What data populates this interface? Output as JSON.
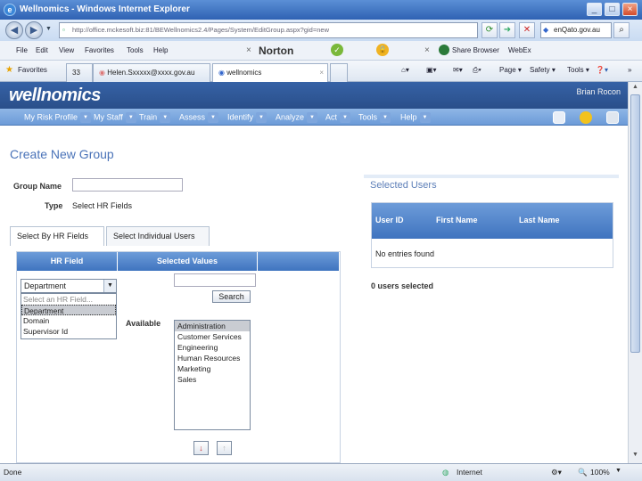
{
  "browser": {
    "title": "Wellnomics - Windows Internet Explorer",
    "address": "http://office.mckesoft.biz:81/BEWellnomics2.4/Pages/System/EditGroup.aspx?gid=new",
    "search_value": "enQato.gov.au",
    "norton": "Norton",
    "share_browser": "Share Browser",
    "webex": "WebEx",
    "menu": [
      "File",
      "Edit",
      "View",
      "Favorites",
      "Tools",
      "Help"
    ],
    "favorites_label": "Favorites",
    "tabs": [
      "Helen.Sxxxxx@xxxx.gov.au",
      "wellnomics"
    ],
    "tab_count": "33",
    "commands": [
      "Page",
      "Safety",
      "Tools"
    ],
    "status_left": "Done",
    "status_zone": "Internet",
    "zoom": "100%"
  },
  "app": {
    "logo": "wellnomics",
    "user": "Brian Rocon",
    "nav": [
      "My Risk Profile",
      "My Staff",
      "Train",
      "Assess",
      "Identify",
      "Analyze",
      "Act",
      "Tools",
      "Help"
    ]
  },
  "page": {
    "title": "Create New Group",
    "group_name_label": "Group Name",
    "group_name_value": "",
    "type_label": "Type",
    "type_value": "Select HR Fields",
    "tabs": [
      "Select By HR Fields",
      "Select Individual Users"
    ],
    "hr_panel": {
      "col_hr_field": "HR Field",
      "col_selected_values": "Selected Values",
      "select_value": "Department",
      "dropdown_options": [
        "Select an HR Field...",
        "Department",
        "Domain",
        "Supervisor Id"
      ],
      "search_value": "",
      "search_button": "Search",
      "available_label": "Available",
      "available_items": [
        "Administration",
        "Customer Services",
        "Engineering",
        "Human Resources",
        "Marketing",
        "Sales"
      ]
    },
    "selected_users": {
      "title": "Selected Users",
      "columns": [
        "User ID",
        "First Name",
        "Last Name"
      ],
      "empty_text": "No entries found",
      "count_text": "0 users selected"
    }
  }
}
